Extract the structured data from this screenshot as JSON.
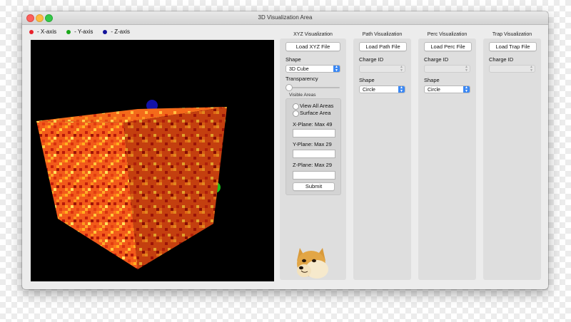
{
  "window": {
    "title": "3D Visualization Area"
  },
  "legend": [
    {
      "label": "- X-axis",
      "color": "#e8202a"
    },
    {
      "label": "- Y-axis",
      "color": "#1aa81a"
    },
    {
      "label": "- Z-axis",
      "color": "#13139a"
    }
  ],
  "xyz_panel": {
    "title": "XYZ Visualization",
    "load_button": "Load XYZ File",
    "shape_label": "Shape",
    "shape_value": "3D Cube",
    "transparency_label": "Transparency",
    "transparency_value": 0,
    "visible_areas_label": "Visible Areas",
    "radio_view_all": "View All Areas",
    "radio_surface": "Surface Area",
    "x_plane_label": "X-Plane: Max 49",
    "y_plane_label": "Y-Plane: Max 29",
    "z_plane_label": "Z-Plane: Max 29",
    "submit_button": "Submit"
  },
  "path_panel": {
    "title": "Path Visualization",
    "load_button": "Load Path File",
    "charge_label": "Charge ID",
    "shape_label": "Shape",
    "shape_value": "Circle"
  },
  "perc_panel": {
    "title": "Perc Visualization",
    "load_button": "Load Perc File",
    "charge_label": "Charge ID",
    "shape_label": "Shape",
    "shape_value": "Circle"
  },
  "trap_panel": {
    "title": "Trap Visualization",
    "load_button": "Load Trap File",
    "charge_label": "Charge ID"
  },
  "icons": {
    "mascot": "shiba-dog-icon",
    "select_arrows": "up-down-chevron-icon"
  }
}
